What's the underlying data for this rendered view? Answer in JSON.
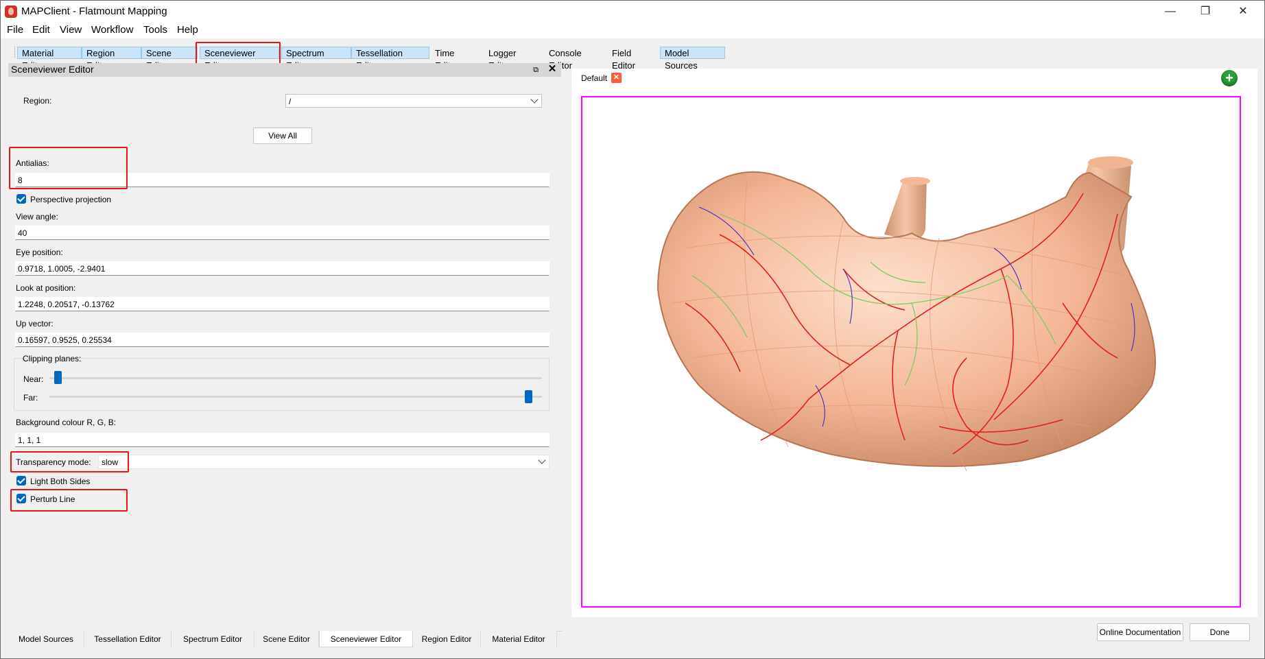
{
  "window": {
    "title": "MAPClient - Flatmount Mapping",
    "minimize_symbol": "—",
    "maximize_symbol": "❐",
    "close_symbol": "✕"
  },
  "menu": [
    "File",
    "Edit",
    "View",
    "Workflow",
    "Tools",
    "Help"
  ],
  "toolbar_tabs": [
    "Material Editor",
    "Region Editor",
    "Scene Editor",
    "Sceneviewer Editor",
    "Spectrum Editor",
    "Tessellation Editor",
    "Time Editor",
    "Logger Editor",
    "Console Editor",
    "Field Editor",
    "Model Sources"
  ],
  "dock": {
    "title": "Sceneviewer Editor",
    "float_icon": "restore-icon",
    "close_symbol": "✕"
  },
  "form": {
    "region_label": "Region:",
    "region_value": "/",
    "view_all": "View All",
    "antialias_label": "Antialias:",
    "antialias_value": "8",
    "perspective_label": "Perspective projection",
    "perspective_checked": true,
    "view_angle_label": "View angle:",
    "view_angle_value": "40",
    "eye_label": "Eye position:",
    "eye_value": "0.9718, 1.0005, -2.9401",
    "lookat_label": "Look at position:",
    "lookat_value": "1.2248, 0.20517, -0.13762",
    "up_label": "Up vector:",
    "up_value": "0.16597, 0.9525, 0.25534",
    "clipping_label": "Clipping planes:",
    "near_label": "Near:",
    "near_level": 0.01,
    "far_label": "Far:",
    "far_level": 0.98,
    "bg_label": "Background colour R, G, B:",
    "bg_value": "1, 1, 1",
    "transparency_label": "Transparency mode:",
    "transparency_value": "slow",
    "light_both_label": "Light Both Sides",
    "light_both_checked": true,
    "perturb_label": "Perturb Line",
    "perturb_checked": true
  },
  "viewer": {
    "tab_label": "Default",
    "tab_close_symbol": "✕",
    "add_symbol": "+",
    "add_icon": "add-icon"
  },
  "bottom_tabs": [
    "Model Sources",
    "Tessellation Editor",
    "Spectrum Editor",
    "Scene Editor",
    "Sceneviewer Editor",
    "Region Editor",
    "Material Editor"
  ],
  "buttons": {
    "online_docs": "Online Documentation",
    "done": "Done"
  },
  "colors": {
    "highlight": "#e8141a",
    "canvas_border": "#ff00ff",
    "accent": "#0067c0",
    "stomach": "#f4b696"
  }
}
